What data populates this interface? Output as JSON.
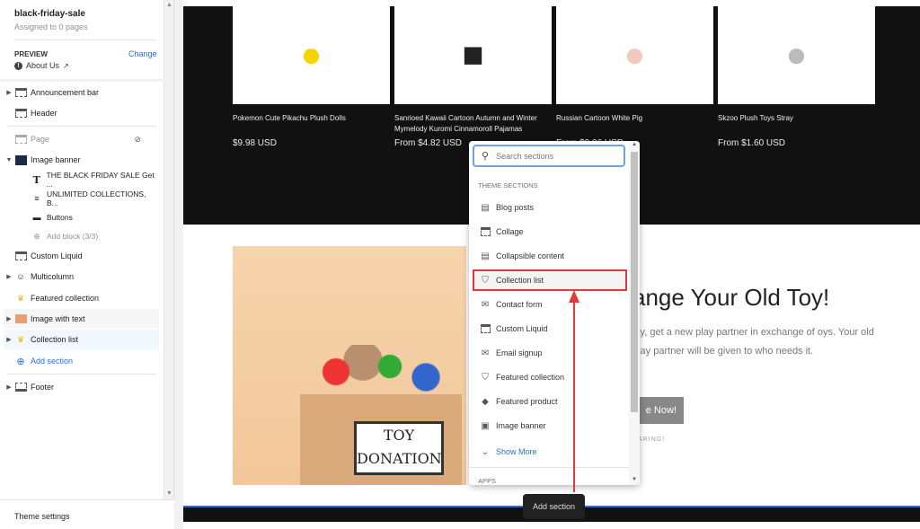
{
  "sidebar": {
    "template_name": "black-friday-sale",
    "assigned": "Assigned to 0 pages",
    "preview_label": "PREVIEW",
    "change_label": "Change",
    "preview_page": "About Us",
    "items": [
      {
        "label": "Announcement bar"
      },
      {
        "label": "Header"
      },
      {
        "label": "Page"
      },
      {
        "label": "Image banner"
      },
      {
        "label": "THE BLACK FRIDAY SALE Get ..."
      },
      {
        "label": "UNLIMITED COLLECTIONS, B..."
      },
      {
        "label": "Buttons"
      },
      {
        "label": "Add block (3/3)"
      },
      {
        "label": "Custom Liquid"
      },
      {
        "label": "Multicolumn"
      },
      {
        "label": "Featured collection"
      },
      {
        "label": "Image with text"
      },
      {
        "label": "Collection list"
      },
      {
        "label": "Add section"
      },
      {
        "label": "Footer"
      }
    ],
    "theme_settings": "Theme settings"
  },
  "preview": {
    "products": [
      {
        "name": "Pokemon Cute Pikachu Plush Dolls",
        "price": "$9.98 USD"
      },
      {
        "name": "Sanrioed Kawaii Cartoon Autumn and Winter Mymelody Kuromi Cinnamoroll Pajamas",
        "price": "From $4.82 USD"
      },
      {
        "name": "Russian Cartoon White Pig",
        "price": "From $9.96 USD"
      },
      {
        "name": "Skzoo Plush Toys Stray",
        "price": "From $1.60 USD"
      }
    ],
    "image_text": "TOY DONATION",
    "heading": "ange Your Old Toy!",
    "paragraph": "lay, get a new play partner in exchange of oys. Your old play partner will be given to who needs it.",
    "button": "e Now!",
    "caption": "CARING!"
  },
  "popup": {
    "search_placeholder": "Search sections",
    "category": "THEME SECTIONS",
    "options": [
      "Blog posts",
      "Collage",
      "Collapsible content",
      "Collection list",
      "Contact form",
      "Custom Liquid",
      "Email signup",
      "Featured collection",
      "Featured product",
      "Image banner"
    ],
    "selected": "Collection list",
    "show_more": "Show More",
    "apps": "APPS"
  },
  "tooltip": "Add section",
  "colors": {
    "accent": "#2c6ecb",
    "highlight": "#e53935"
  }
}
